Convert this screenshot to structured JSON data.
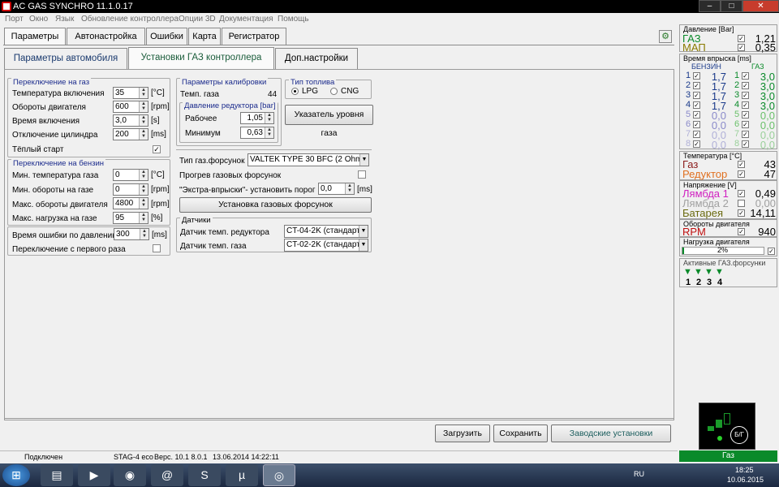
{
  "window": {
    "title": "AC GAS SYNCHRO  11.1.0.17",
    "min": "–",
    "max": "□",
    "close": "✕"
  },
  "menu": [
    "Порт",
    "Окно",
    "Язык",
    "Обновление контроллера",
    "Опции 3D",
    "Документация",
    "Помощь"
  ],
  "tabs": [
    "Параметры",
    "Автонастройка",
    "Ошибки",
    "Карта",
    "Регистратор"
  ],
  "subtabs": [
    "Параметры автомобиля",
    "Установки ГАЗ контроллера",
    "Доп.настройки"
  ],
  "gas_switch": {
    "title": "Переключение на газ",
    "rows": [
      {
        "label": "Температура включения",
        "value": "35",
        "unit": "[°C]"
      },
      {
        "label": "Обороты двигателя",
        "value": "600",
        "unit": "[rpm]"
      },
      {
        "label": "Время включения",
        "value": "3,0",
        "unit": "[s]"
      },
      {
        "label": "Отключение цилиндра",
        "value": "200",
        "unit": "[ms]"
      }
    ],
    "warm_start": "Тёплый старт"
  },
  "petrol_switch": {
    "title": "Переключение на бензин",
    "rows": [
      {
        "label": "Мин. температура газа",
        "value": "0",
        "unit": "[°C]"
      },
      {
        "label": "Мин. обороты на газе",
        "value": "0",
        "unit": "[rpm]"
      },
      {
        "label": "Макс. обороты двигателя",
        "value": "4800",
        "unit": "[rpm]"
      },
      {
        "label": "Макс. нагрузка на газе",
        "value": "95",
        "unit": "[%]"
      }
    ]
  },
  "pressure_error": {
    "label": "Время ошибки по давлению",
    "value": "300",
    "unit": "[ms]"
  },
  "first_time": "Переключение с первого раза",
  "calib": {
    "title": "Параметры калибровки",
    "gas_temp_label": "Темп. газа",
    "gas_temp_value": "44",
    "reducer_title": "Давление редуктора [bar]",
    "work_label": "Рабочее",
    "work_value": "1,05",
    "min_label": "Минимум",
    "min_value": "0,63"
  },
  "fuel": {
    "title": "Тип топлива",
    "lpg": "LPG",
    "cng": "CNG",
    "level_button": "Указатель уровня газа"
  },
  "injectors": {
    "type_label": "Тип газ.форсунок",
    "type_value": "VALTEK TYPE 30 BFC (2 Ohm)",
    "preheat": "Прогрев газовых форсунок",
    "extra_label": "\"Экстра-впрыски\"- установить порог",
    "extra_value": "0,0",
    "extra_unit": "[ms]",
    "setup_button": "Установка газовых форсунок"
  },
  "sensors": {
    "title": "Датчики",
    "reducer_label": "Датчик темп. редуктора",
    "reducer_value": "CT-04-2K (стандарт",
    "gas_label": "Датчик темп. газа",
    "gas_value": "CT-02-2K (стандарт"
  },
  "buttons": {
    "load": "Загрузить",
    "save": "Сохранить",
    "factory": "Заводские установки"
  },
  "status": {
    "connected": "Подключен",
    "device": "STAG-4 eco",
    "version": "Верс. 10.1  8.0.1",
    "date": "13.06.2014 14:22:11",
    "mode": "Газ"
  },
  "right": {
    "pressure": {
      "title": "Давление [Bar]",
      "gas_label": "ГАЗ",
      "gas_value": "1,21",
      "map_label": "МАП",
      "map_value": "0,35"
    },
    "inj_time": {
      "title": "Время впрыска [ms]",
      "petrol": "БЕНЗИН",
      "gas": "ГАЗ",
      "rows": [
        {
          "n": "1",
          "p": "1,7",
          "g": "3,0"
        },
        {
          "n": "2",
          "p": "1,7",
          "g": "3,0"
        },
        {
          "n": "3",
          "p": "1,7",
          "g": "3,0"
        },
        {
          "n": "4",
          "p": "1,7",
          "g": "3,0"
        },
        {
          "n": "5",
          "p": "0,0",
          "g": "0,0"
        },
        {
          "n": "6",
          "p": "0,0",
          "g": "0,0"
        },
        {
          "n": "7",
          "p": "0,0",
          "g": "0,0"
        },
        {
          "n": "8",
          "p": "0,0",
          "g": "0,0"
        }
      ]
    },
    "temp": {
      "title": "Температура  [°C]",
      "gas_label": "Газ",
      "gas_value": "43",
      "red_label": "Редуктор",
      "red_value": "47"
    },
    "voltage": {
      "title": "Напряжение [V]",
      "l1": "Лямбда 1",
      "l1v": "0,49",
      "l2": "Лямбда 2",
      "l2v": "0,00",
      "bat": "Батарея",
      "batv": "14,11"
    },
    "rpm": {
      "title": "Обороты двигателя",
      "label": "RPM",
      "value": "940"
    },
    "load": {
      "title": "Нагрузка двигателя",
      "value": "2%"
    },
    "active": {
      "title": "Активные ГАЗ.форсунки",
      "nums": [
        "1",
        "2",
        "3",
        "4"
      ]
    }
  },
  "taskbar": {
    "lang": "RU",
    "time": "18:25",
    "date": "10.06.2015"
  }
}
